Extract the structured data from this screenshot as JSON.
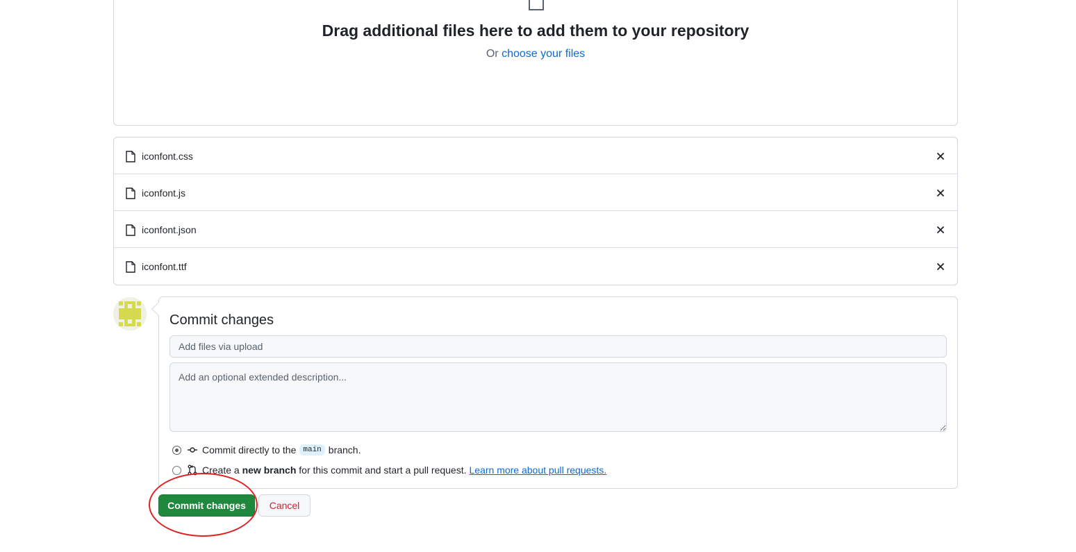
{
  "upload": {
    "title": "Drag additional files here to add them to your repository",
    "or_text": "Or",
    "choose_link": "choose your files"
  },
  "files": [
    {
      "name": "iconfont.css"
    },
    {
      "name": "iconfont.js"
    },
    {
      "name": "iconfont.json"
    },
    {
      "name": "iconfont.ttf"
    }
  ],
  "commit": {
    "title": "Commit changes",
    "summary_placeholder": "Add files via upload",
    "description_placeholder": "Add an optional extended description...",
    "option_direct": {
      "prefix": "Commit directly to the",
      "branch": "main",
      "suffix": "branch.",
      "selected": true
    },
    "option_new_branch": {
      "prefix": "Create a",
      "bold": "new branch",
      "suffix": "for this commit and start a pull request.",
      "link": "Learn more about pull requests.",
      "selected": false
    },
    "submit_label": "Commit changes",
    "cancel_label": "Cancel"
  },
  "colors": {
    "primary_green": "#1f883d",
    "link_blue": "#0969da",
    "danger_red": "#cf222e",
    "annotation_red": "#e02020"
  },
  "icons": {
    "drop_zone": "file-icon",
    "file_row": "file-icon",
    "remove": "x-icon",
    "commit": "git-commit-icon",
    "branch": "git-pull-request-icon"
  }
}
